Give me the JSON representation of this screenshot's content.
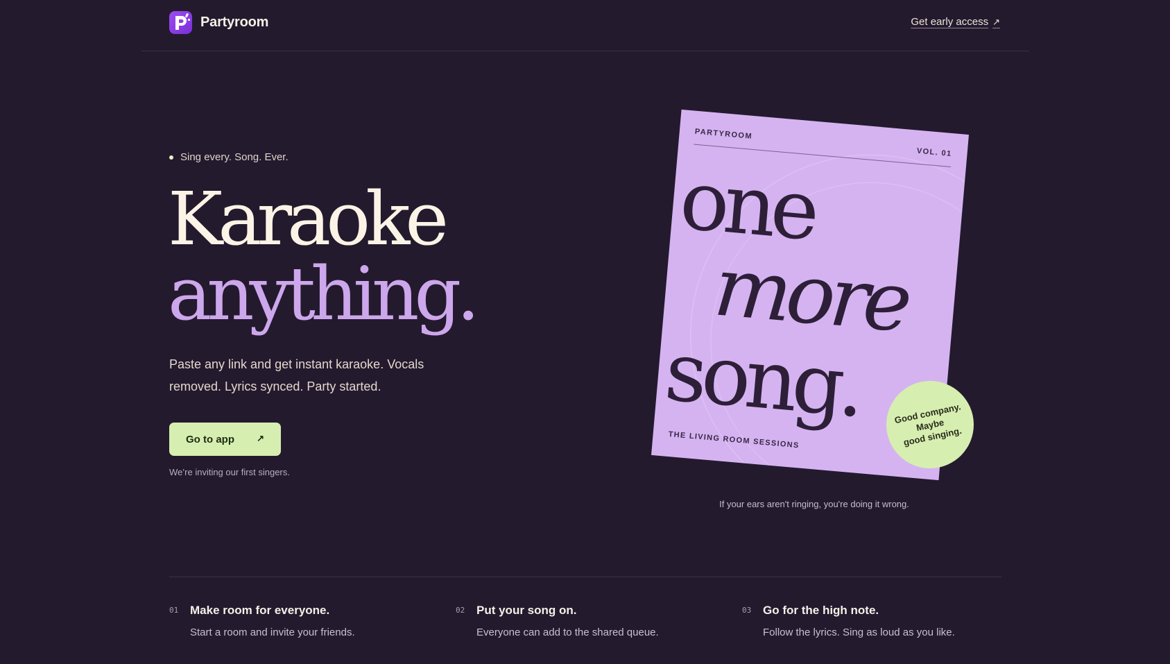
{
  "header": {
    "brand": "Partyroom",
    "early_access": "Get early access",
    "early_access_icon": "arrow-up-right-icon"
  },
  "hero": {
    "eyebrow": "Sing every. Song. Ever.",
    "headline_line1": "Karaoke",
    "headline_line2": "anything.",
    "subtext": "Paste any link and get instant karaoke. Vocals removed. Lyrics synced. Party started.",
    "cta_label": "Go to app",
    "cta_icon": "arrow-up-right-icon",
    "invite_note": "We’re inviting our first singers."
  },
  "poster": {
    "brand": "PARTYROOM",
    "volume": "VOL. 01",
    "word1": "one",
    "word2": "more",
    "word3": "song.",
    "sessions": "THE LIVING ROOM SESSIONS",
    "sticker_line1": "Good company.",
    "sticker_line2": "Maybe",
    "sticker_line3": "good singing.",
    "caption": "If your ears aren't ringing, you're doing it wrong."
  },
  "features": [
    {
      "num": "01",
      "title": "Make room for everyone.",
      "desc": "Start a room and invite your friends."
    },
    {
      "num": "02",
      "title": "Put your song on.",
      "desc": "Everyone can add to the shared queue."
    },
    {
      "num": "03",
      "title": "Go for the high note.",
      "desc": "Follow the lyrics. Sing as loud as you like."
    }
  ],
  "colors": {
    "background": "#241a2e",
    "accent_lavender": "#cda7ec",
    "accent_green": "#d6efb0",
    "cream": "#fbf4e6"
  }
}
